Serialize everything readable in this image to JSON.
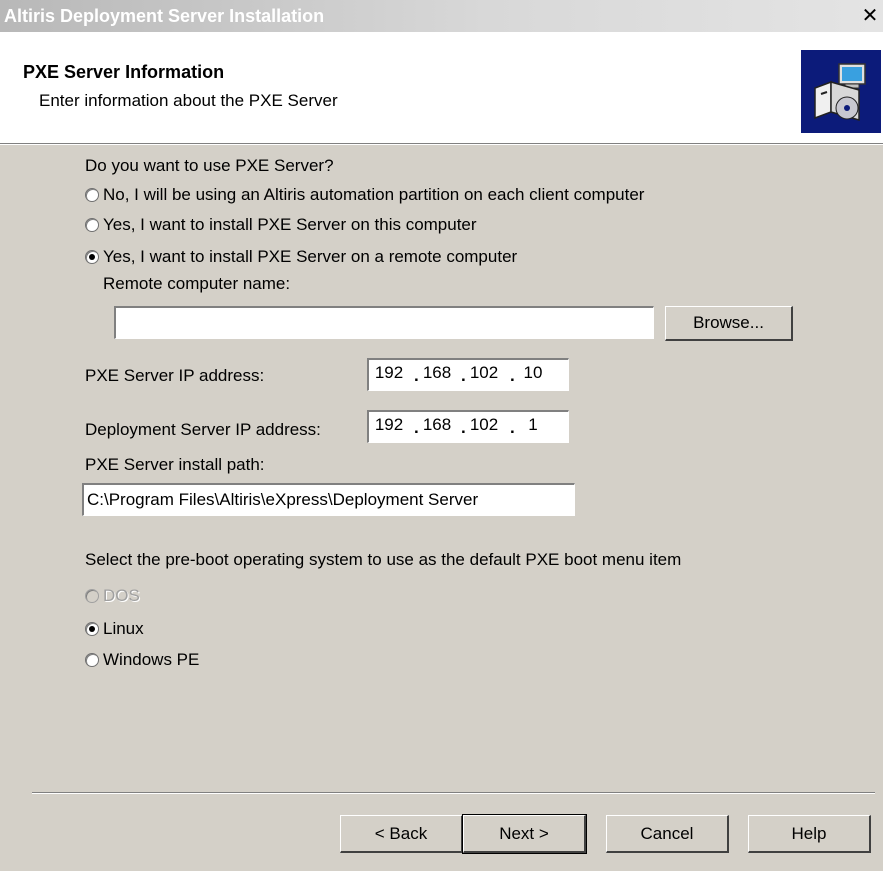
{
  "window": {
    "title": "Altiris Deployment Server Installation",
    "close_glyph": "✕"
  },
  "header": {
    "title": "PXE Server Information",
    "subtitle": "Enter information about the PXE Server",
    "logo_icon": "install-computer-icon"
  },
  "pxe_question": "Do you want to use PXE Server?",
  "pxe_options": [
    {
      "label": "No, I will be using an Altiris automation partition on each client computer",
      "checked": false
    },
    {
      "label": "Yes, I want to install PXE Server on this computer",
      "checked": false
    },
    {
      "label": "Yes, I want to install PXE Server on a remote computer",
      "checked": true
    }
  ],
  "remote_name": {
    "label": "Remote computer name:",
    "value": ""
  },
  "browse_label": "Browse...",
  "pxe_ip": {
    "label": "PXE Server IP address:",
    "octets": [
      "192",
      "168",
      "102",
      "10"
    ]
  },
  "ds_ip": {
    "label": "Deployment Server IP address:",
    "octets": [
      "192",
      "168",
      "102",
      "1"
    ]
  },
  "install_path": {
    "label": "PXE Server install path:",
    "value": "C:\\Program Files\\Altiris\\eXpress\\Deployment Server"
  },
  "preboot": {
    "question": "Select the pre-boot operating system to use as the default PXE boot menu item",
    "options": [
      {
        "label": "DOS",
        "checked": false,
        "enabled": false
      },
      {
        "label": "Linux",
        "checked": true,
        "enabled": true
      },
      {
        "label": "Windows PE",
        "checked": false,
        "enabled": true
      }
    ]
  },
  "buttons": {
    "back": "< Back",
    "next": "Next >",
    "cancel": "Cancel",
    "help": "Help"
  }
}
